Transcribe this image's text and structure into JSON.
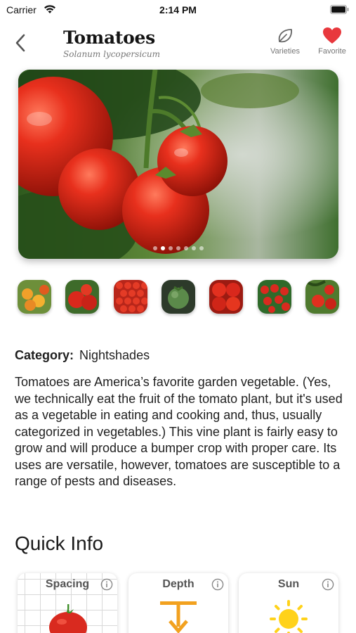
{
  "status_bar": {
    "carrier": "Carrier",
    "time": "2:14 PM"
  },
  "header": {
    "title": "Tomatoes",
    "subtitle": "Solanum lycopersicum",
    "varieties_label": "Varieties",
    "favorite_label": "Favorite"
  },
  "gallery": {
    "page_count": 7,
    "active_index": 1,
    "thumbnail_count": 7
  },
  "details": {
    "category_label": "Category:",
    "category_value": "Nightshades",
    "description": "Tomatoes are America’s favorite garden vegetable. (Yes, we technically eat the fruit of the tomato plant, but it's used as a vegetable in eating and cooking and, thus, usually categorized in vegetables.) This vine plant is fairly easy to grow and will produce a bumper crop with proper care. Its uses are versatile, however, tomatoes are susceptible to a range of pests and diseases."
  },
  "quick_info": {
    "title": "Quick Info",
    "cards": [
      {
        "label": "Spacing",
        "icon": "tomato-icon"
      },
      {
        "label": "Depth",
        "icon": "depth-icon"
      },
      {
        "label": "Sun",
        "icon": "sun-icon"
      }
    ]
  },
  "colors": {
    "favorite": "#e8383d",
    "depth_accent": "#f2a11f",
    "sun_accent": "#ffd21a",
    "tomato": "#d92a1f"
  }
}
